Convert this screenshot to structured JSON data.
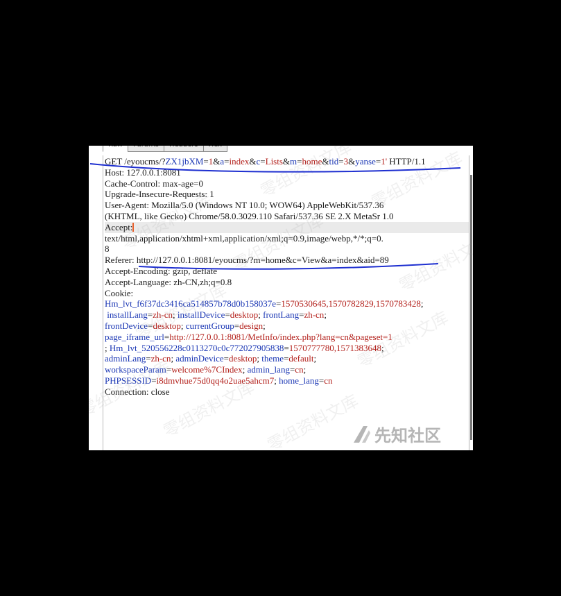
{
  "tabs": [
    {
      "label": "Raw",
      "active": true
    },
    {
      "label": "Params",
      "active": false
    },
    {
      "label": "Headers",
      "active": false
    },
    {
      "label": "Hex",
      "active": false
    }
  ],
  "request": {
    "line1": {
      "method": "GET /eyoucms/?",
      "p1k": "ZX1jbXM",
      "p1v": "1",
      "p2k": "a",
      "p2v": "index",
      "p3k": "c",
      "p3v": "Lists",
      "p4k": "m",
      "p4v": "home",
      "p5k": "tid",
      "p5v": "3",
      "p6k": "yanse",
      "p6v": "1'",
      "version": " HTTP/1.1"
    },
    "host": "Host: 127.0.0.1:8081",
    "cache_control": "Cache-Control: max-age=0",
    "upgrade": "Upgrade-Insecure-Requests: 1",
    "user_agent_1": "User-Agent: Mozilla/5.0 (Windows NT 10.0; WOW64) AppleWebKit/537.36",
    "user_agent_2": "(KHTML, like Gecko) Chrome/58.0.3029.110 Safari/537.36 SE 2.X MetaSr 1.0",
    "accept_label": "Accept:",
    "accept_value_1": "text/html,application/xhtml+xml,application/xml;q=0.9,image/webp,*/*;q=0.",
    "accept_value_2": "8",
    "referer": "Referer: http://127.0.0.1:8081/eyoucms/?m=home&c=View&a=index&aid=89",
    "accept_encoding": "Accept-Encoding: gzip, deflate",
    "accept_language": "Accept-Language: zh-CN,zh;q=0.8",
    "cookie_label": "Cookie:",
    "cookie": {
      "hm_lvt_1_k": "Hm_lvt_f6f37dc3416ca514857b78d0b158037e",
      "hm_lvt_1_v": "1570530645,1570782829,1570783428",
      "install_lang_k": "installLang",
      "install_lang_v": "zh-cn",
      "install_device_k": "installDevice",
      "install_device_v": "desktop",
      "front_lang_k": "frontLang",
      "front_lang_v": "zh-cn",
      "front_device_k": "frontDevice",
      "front_device_v": "desktop",
      "current_group_k": "currentGroup",
      "current_group_v": "design",
      "page_iframe_k": "page_iframe_url",
      "page_iframe_v": "http://127.0.0.1:8081/MetInfo/index.php?lang=cn&pageset=1",
      "hm_lvt_2_k": "Hm_lvt_520556228c0113270c0c772027905838",
      "hm_lvt_2_v": "1570777780,1571383648",
      "admin_lang_k": "adminLang",
      "admin_lang_v": "zh-cn",
      "admin_device_k": "adminDevice",
      "admin_device_v": "desktop",
      "theme_k": "theme",
      "theme_v": "default",
      "workspace_k": "workspaceParam",
      "workspace_v": "welcome%7CIndex",
      "admin_lang2_k": "admin_lang",
      "admin_lang2_v": "cn",
      "phpsessid_k": "PHPSESSID",
      "phpsessid_v": "i8dmvhue75d0qq4o2uae5ahcm7",
      "home_lang_k": "home_lang",
      "home_lang_v": "cn"
    },
    "connection": "Connection: close"
  },
  "watermark": {
    "text": "零组资料文库",
    "brand": "先知社区"
  },
  "colors": {
    "key": "#1a36b4",
    "value": "#b3201b",
    "annotation": "#1e2fd0",
    "cursor": "#e8602c"
  }
}
